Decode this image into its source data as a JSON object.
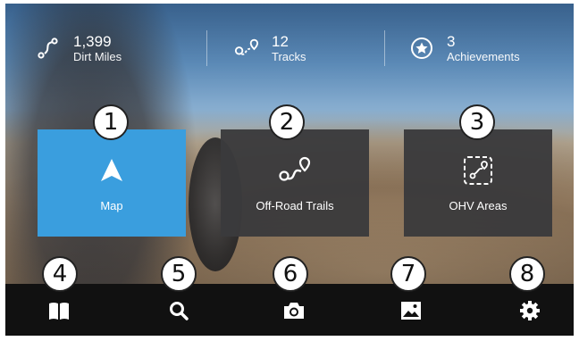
{
  "stats": [
    {
      "value": "1,399",
      "label": "Dirt Miles",
      "icon": "route-icon"
    },
    {
      "value": "12",
      "label": "Tracks",
      "icon": "tracks-icon"
    },
    {
      "value": "3",
      "label": "Achievements",
      "icon": "star-badge-icon"
    }
  ],
  "tiles": [
    {
      "label": "Map",
      "icon": "navigation-arrow-icon",
      "color": "#3a9ede"
    },
    {
      "label": "Off-Road Trails",
      "icon": "trail-route-icon",
      "color": "#3a3a3c"
    },
    {
      "label": "OHV Areas",
      "icon": "ohv-area-icon",
      "color": "#3a3a3c"
    }
  ],
  "nav": [
    {
      "icon": "book-icon"
    },
    {
      "icon": "search-icon"
    },
    {
      "icon": "camera-icon"
    },
    {
      "icon": "photo-icon"
    },
    {
      "icon": "gear-icon"
    }
  ],
  "callouts": [
    "1",
    "2",
    "3",
    "4",
    "5",
    "6",
    "7",
    "8"
  ]
}
